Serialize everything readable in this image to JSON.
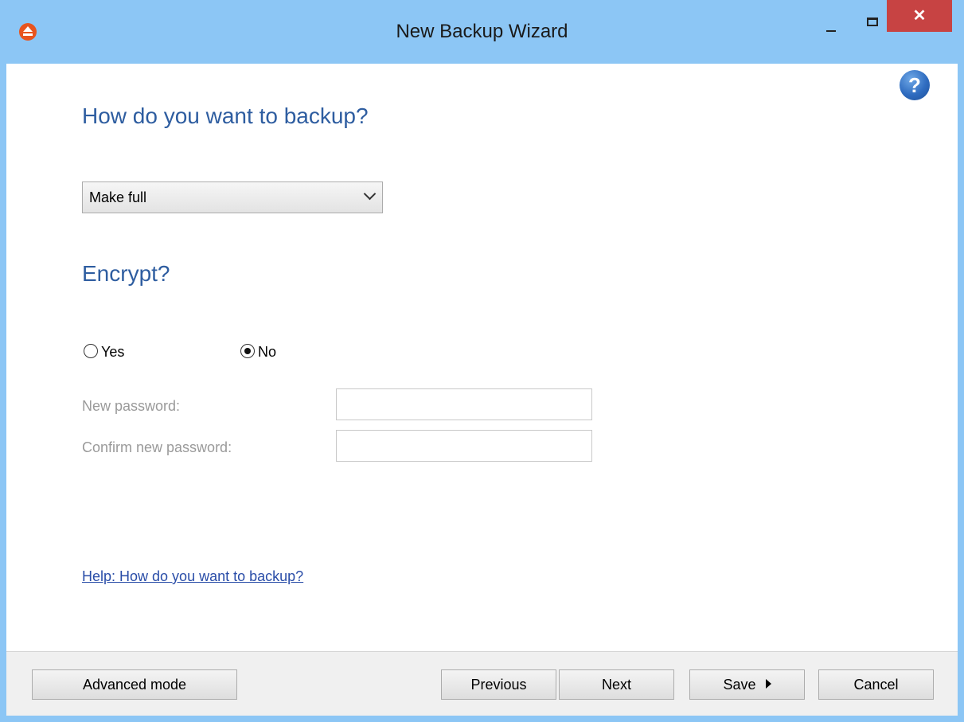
{
  "window": {
    "title": "New Backup Wizard",
    "close_glyph": "✕"
  },
  "main": {
    "heading_backup": "How do you want to backup?",
    "backup_select": {
      "value": "Make full"
    },
    "heading_encrypt": "Encrypt?",
    "radio_yes": {
      "label": "Yes",
      "selected": false
    },
    "radio_no": {
      "label": "No",
      "selected": true
    },
    "new_password_label": "New password:",
    "confirm_password_label": "Confirm new password:",
    "help_link": "Help: How do you want to backup?",
    "help_icon_glyph": "?"
  },
  "footer": {
    "advanced_mode": "Advanced mode",
    "previous": "Previous",
    "next": "Next",
    "save": "Save",
    "cancel": "Cancel"
  },
  "icons": [
    "app-eject-icon",
    "minimize-icon",
    "maximize-icon",
    "close-icon",
    "help-question-icon",
    "chevron-down-icon",
    "caret-right-icon"
  ],
  "colors": {
    "titlebar": "#8cc6f5",
    "close": "#c74343",
    "heading": "#2e5da0",
    "link": "#2a4da8",
    "app_icon": "#e8541e"
  }
}
